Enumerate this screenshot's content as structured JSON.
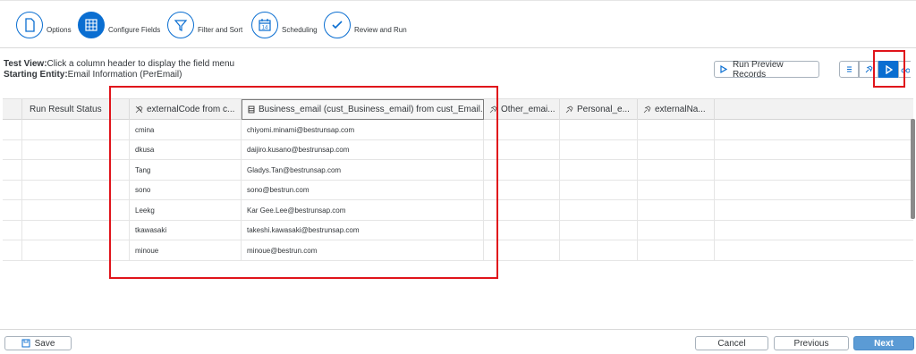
{
  "wizard": {
    "steps": [
      {
        "label": "Options",
        "icon": "document-icon"
      },
      {
        "label": "Configure Fields",
        "icon": "grid-icon"
      },
      {
        "label": "Filter and Sort",
        "icon": "filter-icon"
      },
      {
        "label": "Scheduling",
        "icon": "calendar-icon",
        "day": "14"
      },
      {
        "label": "Review and Run",
        "icon": "checkmark-icon"
      }
    ]
  },
  "info": {
    "test_view_label": "Test View:",
    "test_view_text": "Click a column header to display the field menu",
    "starting_entity_label": "Starting Entity:",
    "starting_entity_text": "Email Information (PerEmail)"
  },
  "toolbar": {
    "run_preview_label": "Run Preview Records"
  },
  "table": {
    "columns": [
      "",
      "Run Result Status",
      "externalCode from c...",
      "Business_email (cust_Business_email) from cust_Email...",
      "Other_emai...",
      "Personal_e...",
      "externalNa..."
    ],
    "rows": [
      [
        "cmina",
        "chiyomi.minami@bestrunsap.com"
      ],
      [
        "dkusa",
        "daijiro.kusano@bestrunsap.com"
      ],
      [
        "Tang",
        "Gladys.Tan@bestrunsap.com"
      ],
      [
        "sono",
        "sono@bestrun.com"
      ],
      [
        "Leekg",
        "Kar Gee.Lee@bestrunsap.com"
      ],
      [
        "tkawasaki",
        "takeshi.kawasaki@bestrunsap.com"
      ],
      [
        "minoue",
        "minoue@bestrun.com"
      ]
    ]
  },
  "footer": {
    "save_label": "Save",
    "cancel_label": "Cancel",
    "previous_label": "Previous",
    "next_label": "Next"
  },
  "colors": {
    "accent": "#0a6ed1",
    "highlight": "#e0141b",
    "next_button": "#5b9bd5"
  }
}
